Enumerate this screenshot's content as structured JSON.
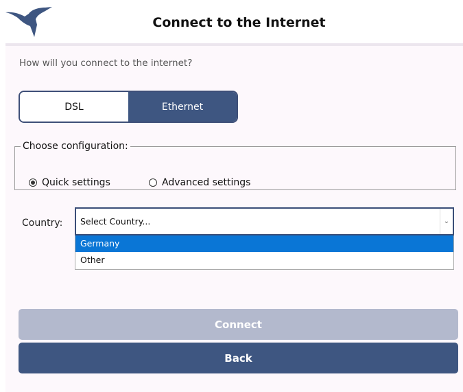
{
  "header": {
    "title": "Connect to the Internet",
    "logo_icon": "hummingbird-icon",
    "brand_color": "#3e5681"
  },
  "main": {
    "question": "How will you connect to the internet?",
    "connection_types": [
      {
        "label": "DSL",
        "selected": false
      },
      {
        "label": "Ethernet",
        "selected": true
      }
    ],
    "configuration": {
      "legend": "Choose configuration:",
      "options": [
        {
          "label": "Quick settings",
          "checked": true
        },
        {
          "label": "Advanced settings",
          "checked": false
        }
      ]
    },
    "country": {
      "label": "Country:",
      "placeholder": "Select Country...",
      "options": [
        {
          "label": "Germany",
          "highlighted": true
        },
        {
          "label": "Other",
          "highlighted": false
        }
      ]
    },
    "buttons": {
      "connect": "Connect",
      "back": "Back"
    }
  }
}
